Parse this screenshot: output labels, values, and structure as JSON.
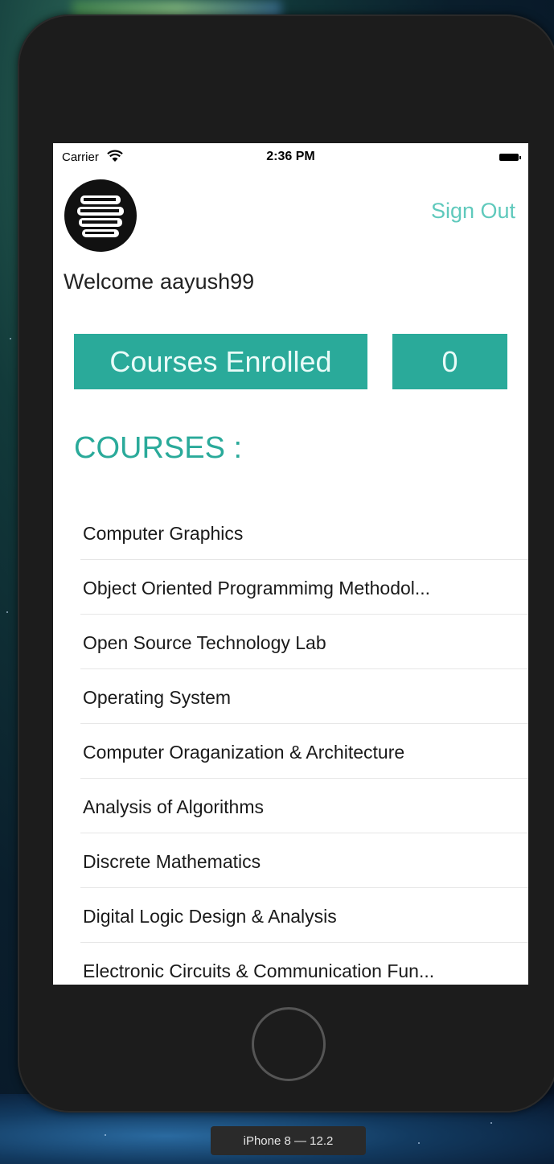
{
  "status_bar": {
    "carrier": "Carrier",
    "time": "2:36 PM",
    "wifi_icon": "wifi-icon",
    "battery_icon": "battery-icon"
  },
  "header": {
    "logo_icon": "books-stack-logo",
    "sign_out_label": "Sign Out"
  },
  "welcome": {
    "greeting": "Welcome",
    "username": "aayush99"
  },
  "stats": {
    "courses_enrolled_label": "Courses Enrolled",
    "courses_enrolled_count": "0"
  },
  "courses": {
    "heading": "COURSES :",
    "items": [
      "Computer Graphics",
      "Object Oriented Programmimg Methodol...",
      "Open Source Technology Lab",
      "Operating System",
      "Computer Oraganization & Architecture",
      "Analysis of Algorithms",
      "Discrete Mathematics",
      "Digital Logic Design & Analysis",
      "Electronic Circuits & Communication Fun..."
    ]
  },
  "simulator": {
    "device_label": "iPhone 8 — 12.2"
  },
  "colors": {
    "accent": "#2aaa9a",
    "sign_out": "#5fc9bc",
    "device_frame": "#1c1c1c"
  }
}
